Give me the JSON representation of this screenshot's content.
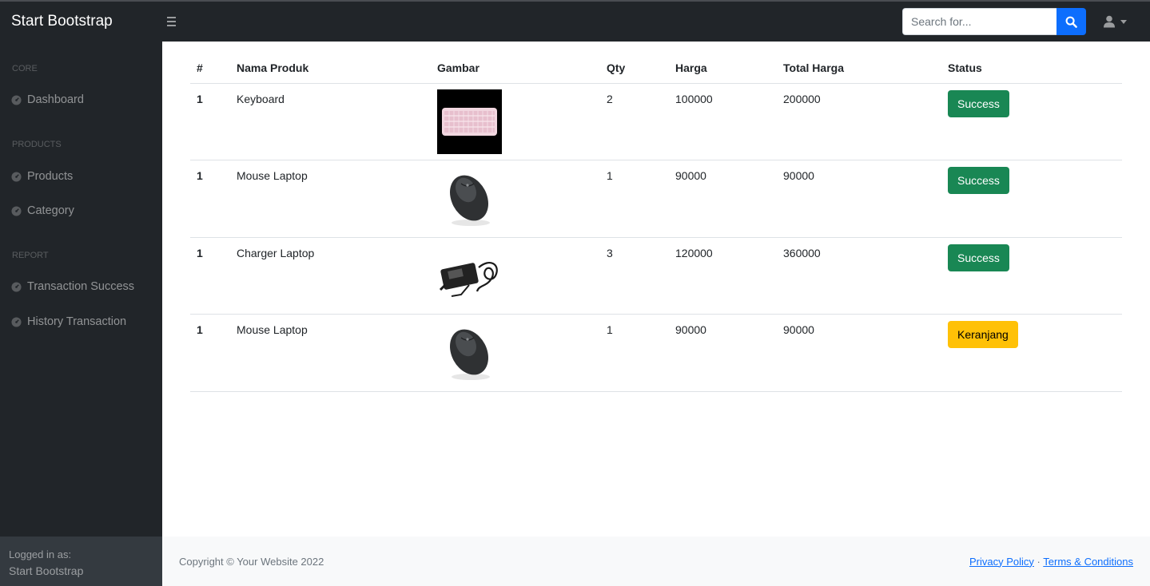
{
  "navbar": {
    "brand": "Start Bootstrap",
    "search_placeholder": "Search for..."
  },
  "sidebar": {
    "headings": [
      "Core",
      "Products",
      "Report"
    ],
    "items": [
      {
        "label": "Dashboard"
      },
      {
        "label": "Products"
      },
      {
        "label": "Category"
      },
      {
        "label": "Transaction Success"
      },
      {
        "label": "History Transaction"
      }
    ],
    "footer": {
      "logged_in_label": "Logged in as:",
      "user_name": "Start Bootstrap"
    }
  },
  "table": {
    "headers": [
      "#",
      "Nama Produk",
      "Gambar",
      "Qty",
      "Harga",
      "Total Harga",
      "Status"
    ],
    "rows": [
      {
        "num": "1",
        "name": "Keyboard",
        "image": "keyboard",
        "qty": "2",
        "price": "100000",
        "total": "200000",
        "status": "Success"
      },
      {
        "num": "1",
        "name": "Mouse Laptop",
        "image": "mouse",
        "qty": "1",
        "price": "90000",
        "total": "90000",
        "status": "Success"
      },
      {
        "num": "1",
        "name": "Charger Laptop",
        "image": "charger",
        "qty": "3",
        "price": "120000",
        "total": "360000",
        "status": "Success"
      },
      {
        "num": "1",
        "name": "Mouse Laptop",
        "image": "mouse",
        "qty": "1",
        "price": "90000",
        "total": "90000",
        "status": "Keranjang"
      }
    ]
  },
  "footer": {
    "copyright": "Copyright © Your Website 2022",
    "privacy": "Privacy Policy",
    "separator": "·",
    "terms": "Terms & Conditions"
  },
  "colors": {
    "dark": "#212529",
    "success": "#198754",
    "warning": "#ffc107",
    "primary": "#0d6efd"
  },
  "icons": {
    "toggler": "bars-icon",
    "search": "search-icon",
    "user": "user-icon",
    "nav": "tachometer-icon"
  }
}
